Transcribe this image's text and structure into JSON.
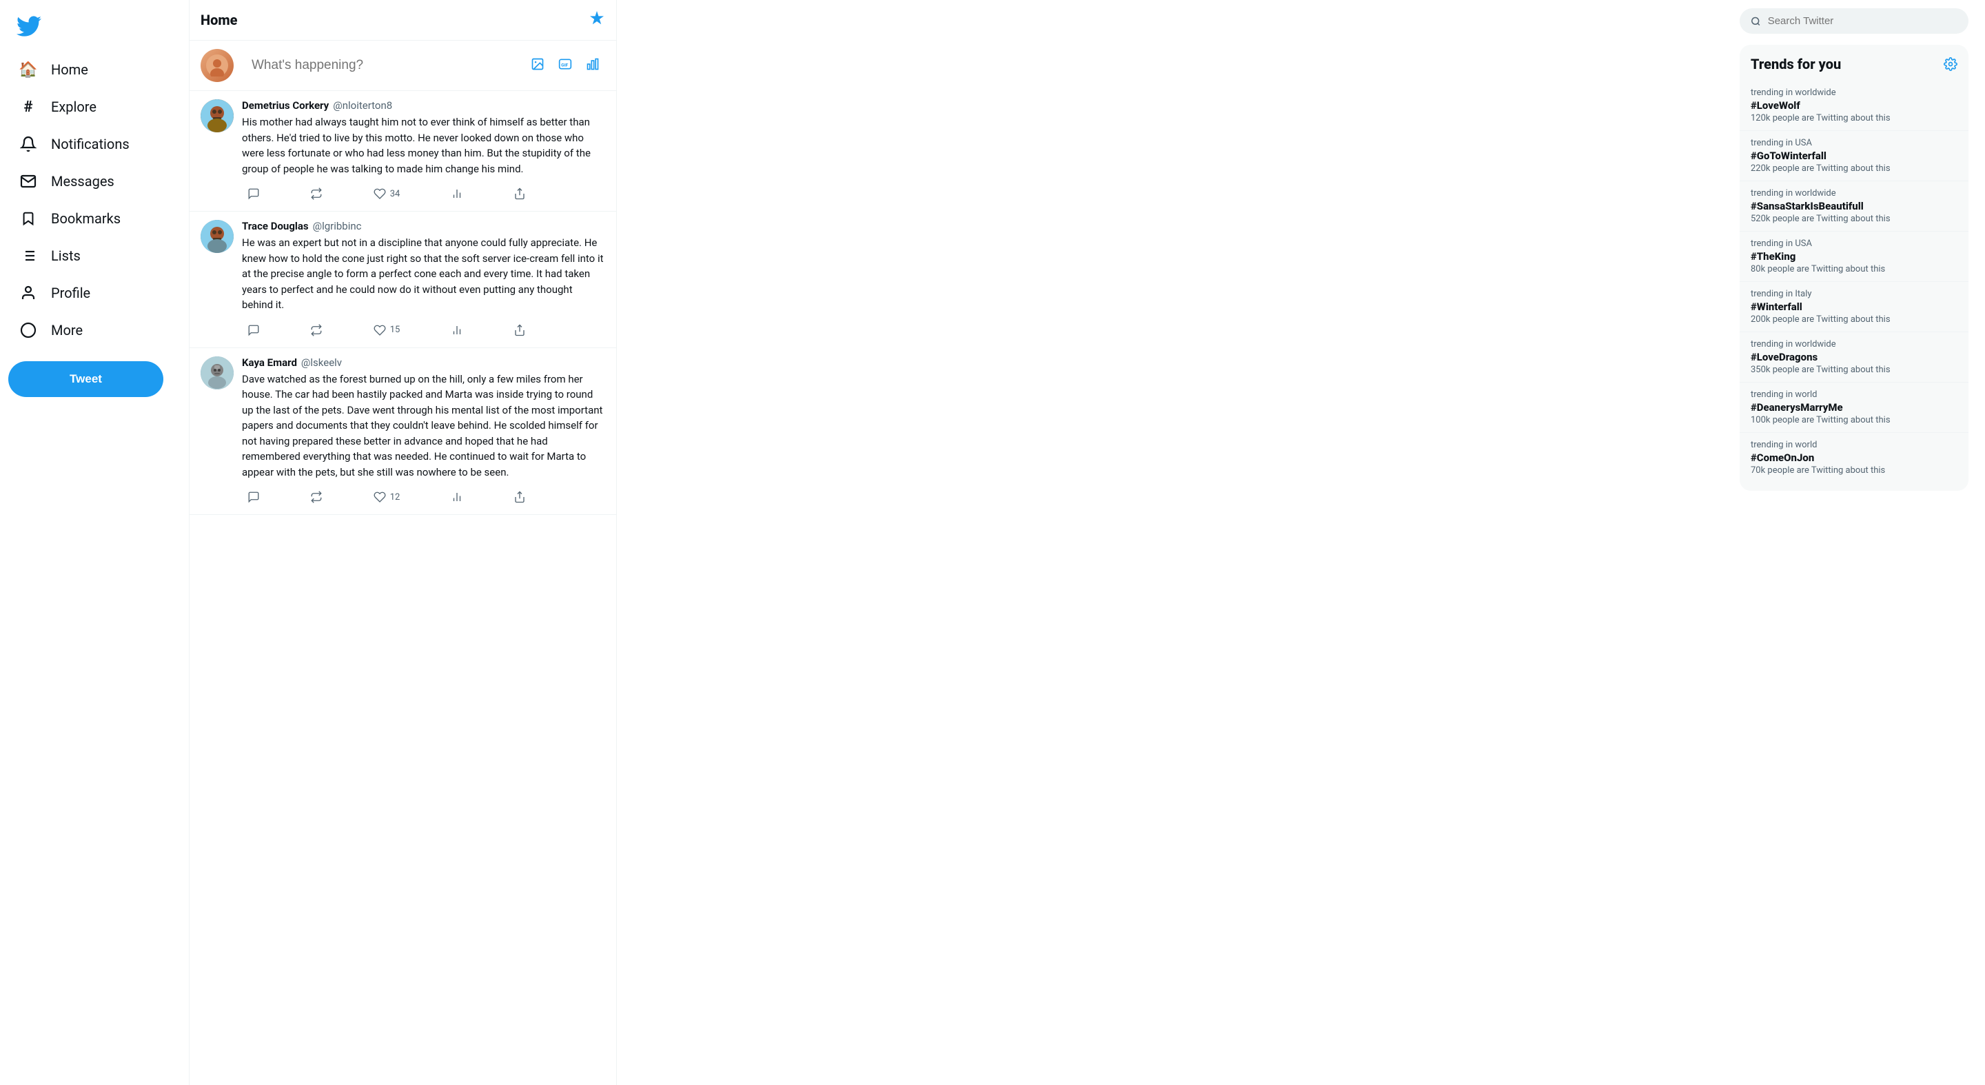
{
  "sidebar": {
    "logo_label": "Twitter",
    "nav_items": [
      {
        "id": "home",
        "label": "Home",
        "icon": "🏠"
      },
      {
        "id": "explore",
        "label": "Explore",
        "icon": "#"
      },
      {
        "id": "notifications",
        "label": "Notifications",
        "icon": "🔔"
      },
      {
        "id": "messages",
        "label": "Messages",
        "icon": "✉"
      },
      {
        "id": "bookmarks",
        "label": "Bookmarks",
        "icon": "🔖"
      },
      {
        "id": "lists",
        "label": "Lists",
        "icon": "📋"
      },
      {
        "id": "profile",
        "label": "Profile",
        "icon": "👤"
      },
      {
        "id": "more",
        "label": "More",
        "icon": "⋯"
      }
    ],
    "tweet_button_label": "Tweet"
  },
  "feed": {
    "header_title": "Home",
    "compose_placeholder": "What's happening?",
    "tweets": [
      {
        "id": "tweet1",
        "name": "Demetrius Corkery",
        "handle": "@nloiterton8",
        "text": "His mother had always taught him not to ever think of himself as better than others. He'd tried to live by this motto. He never looked down on those who were less fortunate or who had less money than him. But the stupidity of the group of people he was talking to made him change his mind.",
        "likes": 34,
        "avatar_style": "1"
      },
      {
        "id": "tweet2",
        "name": "Trace Douglas",
        "handle": "@lgribbinc",
        "text": "He was an expert but not in a discipline that anyone could fully appreciate. He knew how to hold the cone just right so that the soft server ice-cream fell into it at the precise angle to form a perfect cone each and every time. It had taken years to perfect and he could now do it without even putting any thought behind it.",
        "likes": 15,
        "avatar_style": "2"
      },
      {
        "id": "tweet3",
        "name": "Kaya Emard",
        "handle": "@lskeelv",
        "text": "Dave watched as the forest burned up on the hill, only a few miles from her house. The car had been hastily packed and Marta was inside trying to round up the last of the pets. Dave went through his mental list of the most important papers and documents that they couldn't leave behind. He scolded himself for not having prepared these better in advance and hoped that he had remembered everything that was needed. He continued to wait for Marta to appear with the pets, but she still was nowhere to be seen.",
        "likes": 12,
        "avatar_style": "3"
      }
    ]
  },
  "right_sidebar": {
    "search_placeholder": "Search Twitter",
    "trends_title": "Trends for you",
    "trends": [
      {
        "category": "trending in worldwide",
        "hashtag": "#LoveWolf",
        "count": "120k people are Twitting about this"
      },
      {
        "category": "trending in USA",
        "hashtag": "#GoToWinterfall",
        "count": "220k people are Twitting about this"
      },
      {
        "category": "trending in worldwide",
        "hashtag": "#SansaStarkIsBeautifull",
        "count": "520k people are Twitting about this"
      },
      {
        "category": "trending in USA",
        "hashtag": "#TheKing",
        "count": "80k people are Twitting about this"
      },
      {
        "category": "trending in Italy",
        "hashtag": "#Winterfall",
        "count": "200k people are Twitting about this"
      },
      {
        "category": "trending in worldwide",
        "hashtag": "#LoveDragons",
        "count": "350k people are Twitting about this"
      },
      {
        "category": "trending in world",
        "hashtag": "#DeanerysMarryMe",
        "count": "100k people are Twitting about this"
      },
      {
        "category": "trending in world",
        "hashtag": "#ComeOnJon",
        "count": "70k people are Twitting about this"
      }
    ]
  }
}
